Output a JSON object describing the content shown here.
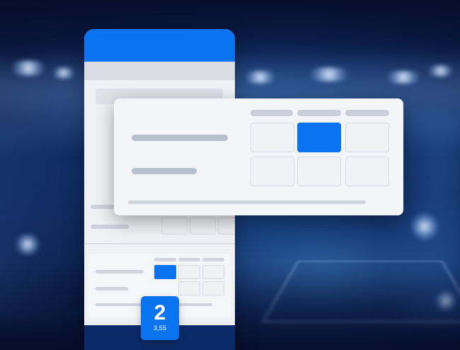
{
  "odds_badge": {
    "selection": "2",
    "odds": "3,55"
  },
  "colors": {
    "accent": "#0a73f0",
    "footer": "#0b2a68",
    "background": "#0f2c63"
  },
  "bet_card": {
    "selected_cell_index": 1
  },
  "phone": {
    "selected_cell_index": 0
  }
}
